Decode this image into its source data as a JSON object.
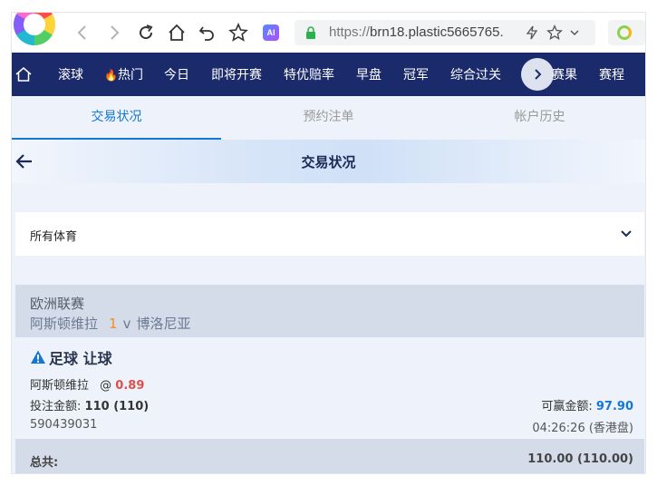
{
  "browser": {
    "url_prefix": "https://",
    "url_host": "brn18.plastic5665765.",
    "ai_badge": "AI"
  },
  "nav": {
    "items": [
      "滚球",
      "热门",
      "今日",
      "即将开赛",
      "特优赔率",
      "早盘",
      "冠军",
      "综合过关",
      "赛果",
      "赛程"
    ],
    "hot_emoji": "🔥"
  },
  "tabs": [
    "交易状况",
    "预约注单",
    "帐户历史"
  ],
  "header": {
    "title": "交易状况"
  },
  "filter": {
    "selected": "所有体育"
  },
  "league": {
    "name": "欧洲联赛",
    "home": "阿斯顿维拉",
    "score": "1",
    "vs": "v",
    "away": "博洛尼亚"
  },
  "bet": {
    "title": "足球 让球",
    "selection": "阿斯顿维拉",
    "at": "@",
    "odds": "0.89",
    "stake_label": "投注金额:",
    "stake_value": "110 (110)",
    "win_label": "可赢金额:",
    "win_value": "97.90",
    "ref_id": "590439031",
    "time": "04:26:26 (香港盘)"
  },
  "total": {
    "label": "总共:",
    "value": "110.00 (110.00)"
  },
  "colors": {
    "nav_bg": "#1b2a6b",
    "accent": "#1477d6",
    "odds": "#e0504a",
    "score": "#f0901f"
  }
}
